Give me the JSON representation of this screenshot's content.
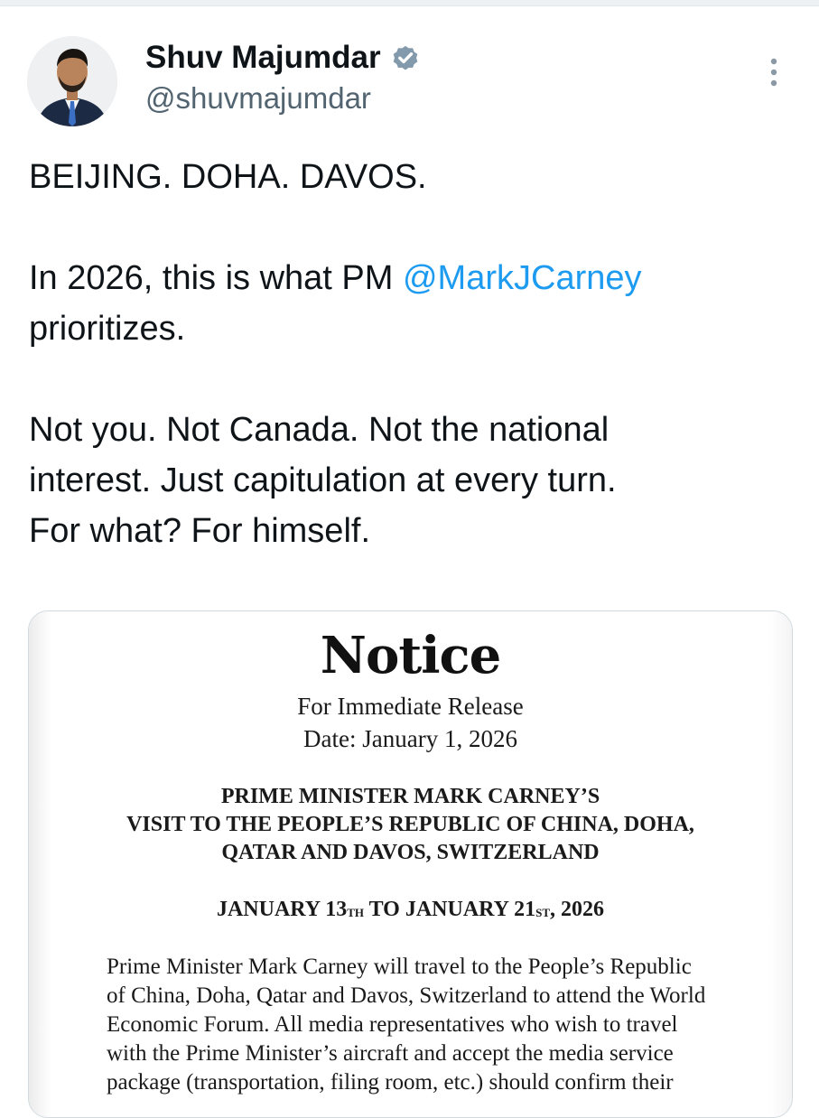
{
  "tweet": {
    "author_name": "Shuv Majumdar",
    "author_handle": "@shuvmajumdar",
    "verified": true,
    "lines": {
      "p1": "BEIJING. DOHA. DAVOS.",
      "p2_pre": "In 2026, this is what PM ",
      "p2_mention": "@MarkJCarney",
      "p2_post": "prioritizes.",
      "p3_line1": "Not you. Not Canada. Not the national",
      "p3_line2": "interest. Just capitulation at every turn.",
      "p3_line3": "For what? For himself."
    }
  },
  "notice": {
    "title": "Notice",
    "release": "For Immediate Release",
    "date": "Date: January 1, 2026",
    "heading_line1": "PRIME MINISTER MARK CARNEY’S",
    "heading_line2": "VISIT TO THE PEOPLE’S REPUBLIC OF CHINA, DOHA,",
    "heading_line3": "QATAR AND DAVOS, SWITZERLAND",
    "dates_pre": "JANUARY 13",
    "dates_sup1": "TH",
    "dates_mid": " TO JANUARY 21",
    "dates_sup2": "ST",
    "dates_post": ", 2026",
    "body_line1": "Prime Minister Mark Carney will travel to the People’s Republic",
    "body_line2": "of China, Doha, Qatar and Davos, Switzerland to attend the World",
    "body_line3": "Economic Forum. All media representatives who wish to travel",
    "body_line4": "with the Prime Minister’s aircraft and accept the media service",
    "body_line5": "package (transportation, filing room, etc.) should confirm their"
  },
  "colors": {
    "text": "#0f1419",
    "secondary": "#536471",
    "mention": "#1d9bf0",
    "verified_badge": "#829aab"
  },
  "icons": {
    "verified": "verified-badge-icon",
    "more": "more-vertical-icon"
  }
}
